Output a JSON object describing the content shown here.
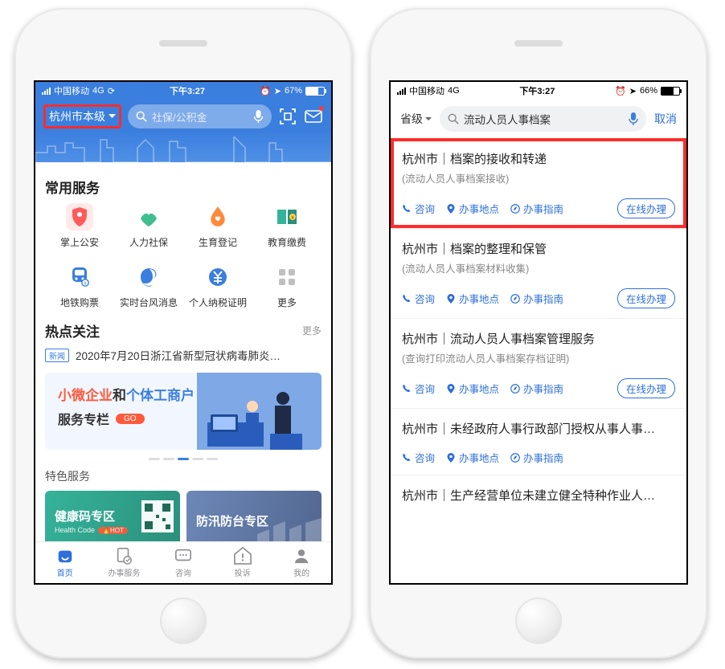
{
  "status": {
    "carrier": "中国移动",
    "network": "4G",
    "time": "下午3:27",
    "battery_left": "67%",
    "battery_right": "66%"
  },
  "left": {
    "location": "杭州市本级",
    "search_placeholder": "社保/公积金",
    "common_services_title": "常用服务",
    "services": [
      {
        "label": "掌上公安"
      },
      {
        "label": "人力社保"
      },
      {
        "label": "生育登记"
      },
      {
        "label": "教育缴费"
      },
      {
        "label": "地铁购票"
      },
      {
        "label": "实时台风消息"
      },
      {
        "label": "个人纳税证明"
      },
      {
        "label": "更多"
      }
    ],
    "hot_title": "热点关注",
    "more_label": "更多",
    "news_badge": "新闻",
    "news_text": "2020年7月20日浙江省新型冠状病毒肺炎…",
    "banner": {
      "line1_a": "小微企业",
      "line1_b": "和",
      "line1_c": "个体工商户",
      "line2": "服务专栏",
      "go": "GO"
    },
    "special_title": "特色服务",
    "feat_a_title": "健康码专区",
    "feat_a_sub": "Health Code",
    "feat_a_hot": "HOT",
    "feat_b_title": "防汛防台专区",
    "tabs": [
      {
        "label": "首页"
      },
      {
        "label": "办事服务"
      },
      {
        "label": "咨询"
      },
      {
        "label": "投诉"
      },
      {
        "label": "我的"
      }
    ]
  },
  "right": {
    "level": "省级",
    "search_value": "流动人员人事档案",
    "cancel": "取消",
    "act_consult": "咨询",
    "act_location": "办事地点",
    "act_guide": "办事指南",
    "act_online": "在线办理",
    "results": [
      {
        "title": "杭州市｜档案的接收和转递",
        "sub": "(流动人员人事档案接收)",
        "has_btn": true
      },
      {
        "title": "杭州市｜档案的整理和保管",
        "sub": "(流动人员人事档案材料收集)",
        "has_btn": true
      },
      {
        "title": "杭州市｜流动人员人事档案管理服务",
        "sub": "(查询打印流动人员人事档案存档证明)",
        "has_btn": true
      },
      {
        "title": "杭州市｜未经政府人事行政部门授权从事人事…",
        "sub": "",
        "has_btn": false
      },
      {
        "title": "杭州市｜生产经营单位未建立健全特种作业人…",
        "sub": "",
        "has_btn": false
      }
    ]
  }
}
